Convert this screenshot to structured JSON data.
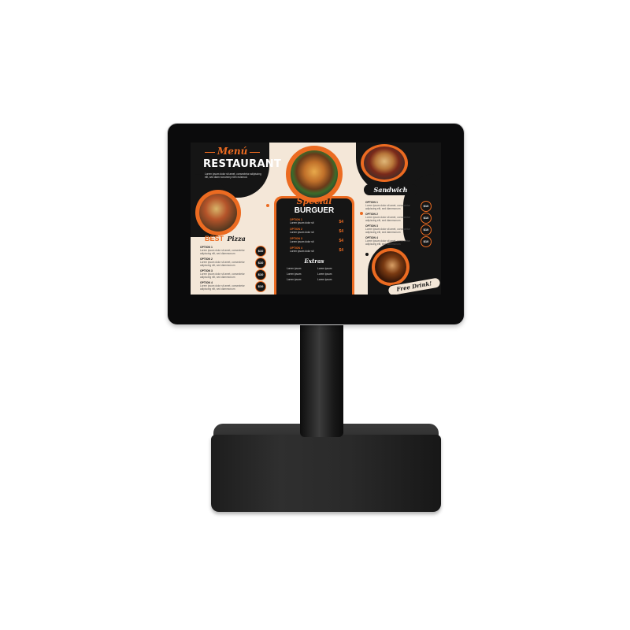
{
  "menu": {
    "menu_title": "Menú",
    "restaurant": "RESTAURANT",
    "intro": "Lorem ipsum dolor sit amet, consectetur adipiscing elit, sed diam nonummy nibh euismod.",
    "best_label": "BEST",
    "pizza_label": "Pizza",
    "special_label": "Special",
    "burguer_label": "BURGUER",
    "sandwich_label": "Sandwich",
    "extras_label": "Extras",
    "free_drink_label": "Free Drink!",
    "pizza_options": [
      {
        "name": "OPTION 1",
        "desc": "Lorem ipsum dolor sit amet, consectetur adipiscing elit, sed diammonum",
        "price": "$10"
      },
      {
        "name": "OPTION 2",
        "desc": "Lorem ipsum dolor sit amet, consectetur adipiscing elit, sed diammonum",
        "price": "$10"
      },
      {
        "name": "OPTION 3",
        "desc": "Lorem ipsum dolor sit amet, consectetur adipiscing elit, sed diammonum",
        "price": "$10"
      },
      {
        "name": "OPTION 4",
        "desc": "Lorem ipsum dolor sit amet, consectetur adipiscing elit, sed diammonum",
        "price": "$10"
      }
    ],
    "burguer_options": [
      {
        "name": "OPTION 1",
        "desc": "Lorem ipsum dolor sit",
        "price": "$4"
      },
      {
        "name": "OPTION 2",
        "desc": "Lorem ipsum dolor sit",
        "price": "$4"
      },
      {
        "name": "OPTION 3",
        "desc": "Lorem ipsum dolor sit",
        "price": "$4"
      },
      {
        "name": "OPTION 4",
        "desc": "Lorem ipsum dolor sit",
        "price": "$4"
      }
    ],
    "extras": [
      "Lorem ipsum",
      "Lorem ipsum",
      "Lorem ipsum",
      "Lorem ipsum",
      "Lorem ipsum",
      "Lorem ipsum"
    ],
    "sandwich_options": [
      {
        "name": "OPTION 1",
        "desc": "Lorem ipsum dolor sit amet, consectetur adipiscing elit, sed diammonum",
        "price": "$10"
      },
      {
        "name": "OPTION 2",
        "desc": "Lorem ipsum dolor sit amet, consectetur adipiscing elit, sed diammonum",
        "price": "$10"
      },
      {
        "name": "OPTION 3",
        "desc": "Lorem ipsum dolor sit amet, consectetur adipiscing elit, sed diammonum",
        "price": "$10"
      },
      {
        "name": "OPTION 4",
        "desc": "Lorem ipsum dolor sit amet, consectetur adipiscing elit, sed diammonum",
        "price": "$10"
      }
    ]
  },
  "colors": {
    "accent": "#ec6b21",
    "dark": "#151515",
    "cream": "#f4e7d8"
  }
}
